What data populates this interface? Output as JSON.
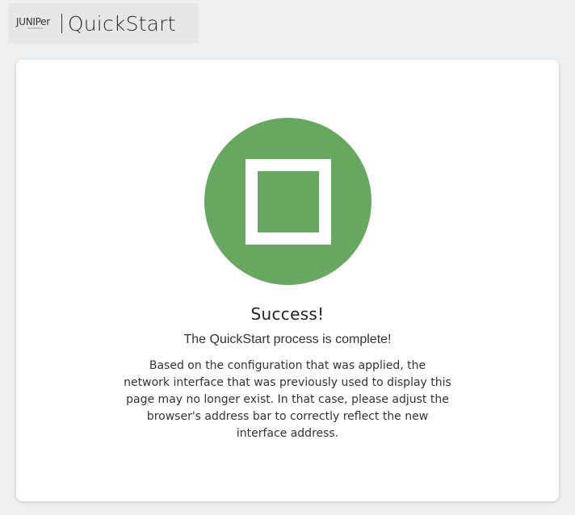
{
  "header": {
    "logo_text": "JUNIPer",
    "logo_subtext": "NETWORKS",
    "app_title": "QuickStart"
  },
  "result": {
    "icon": "success-square-icon",
    "color": "#66a85f",
    "title": "Success!",
    "subtitle": "The QuickStart process is complete!",
    "message_lines": [
      "Based on the configuration that was applied, the",
      "network interface that was previously used to display this",
      "page may no longer exist. In that case, please adjust the",
      "browser's address bar to correctly reflect the new",
      "interface address."
    ]
  }
}
